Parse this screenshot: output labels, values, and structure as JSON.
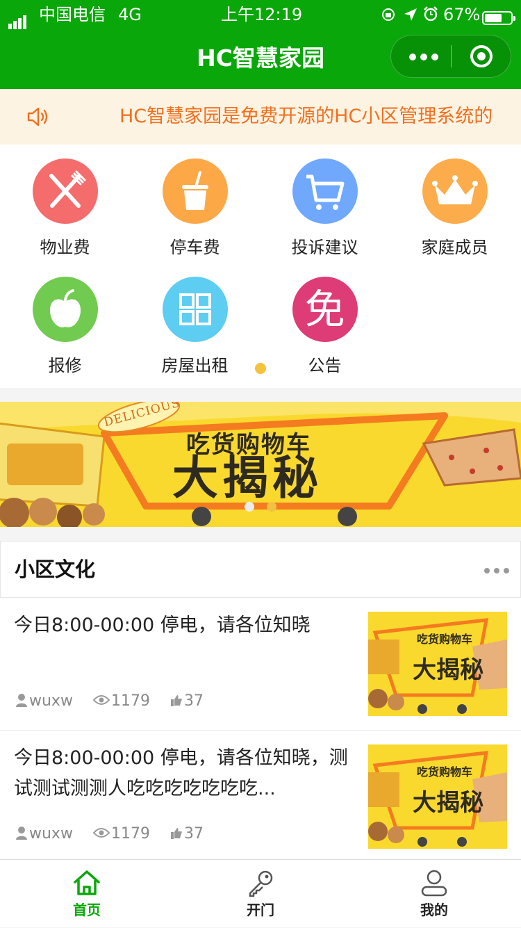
{
  "status_bar": {
    "carrier": "中国电信",
    "network": "4G",
    "time": "上午12:19",
    "battery_percent": "67%",
    "battery_level": 0.67
  },
  "nav": {
    "title": "HC智慧家园"
  },
  "notice": {
    "text": "HC智慧家园是免费开源的HC小区管理系统的",
    "icon": "speaker-icon"
  },
  "grid": {
    "items": [
      {
        "label": "物业费",
        "icon": "fork-knife-icon",
        "color": "#f56c6c"
      },
      {
        "label": "停车费",
        "icon": "cup-icon",
        "color": "#fda847"
      },
      {
        "label": "投诉建议",
        "icon": "cart-icon",
        "color": "#6fa8fc"
      },
      {
        "label": "家庭成员",
        "icon": "crown-icon",
        "color": "#fcac4a"
      },
      {
        "label": "报修",
        "icon": "apple-icon",
        "color": "#70cb50"
      },
      {
        "label": "房屋出租",
        "icon": "grid-icon",
        "color": "#5dcdf1"
      },
      {
        "label": "公告",
        "icon": "免",
        "color": "#dd3c76"
      }
    ],
    "active_page": 1,
    "page_count": 1
  },
  "banner": {
    "badge_text": "DELICIOUS",
    "small_text": "吃货购物车",
    "big_text": "大揭秘",
    "active_slide": 2,
    "slide_count": 2
  },
  "culture": {
    "title": "小区文化",
    "articles": [
      {
        "title": "今日8:00-00:00 停电，请各位知晓",
        "author": "wuxw",
        "views": "1179",
        "likes": "37"
      },
      {
        "title": "今日8:00-00:00 停电，请各位知晓，测试测试测测人吃吃吃吃吃吃吃...",
        "author": "wuxw",
        "views": "1179",
        "likes": "37"
      }
    ]
  },
  "tabbar": {
    "items": [
      {
        "label": "首页",
        "icon": "home-icon",
        "active": true
      },
      {
        "label": "开门",
        "icon": "key-icon",
        "active": false
      },
      {
        "label": "我的",
        "icon": "user-icon",
        "active": false
      }
    ],
    "active_color": "#09a709",
    "inactive_color": "#555555"
  }
}
